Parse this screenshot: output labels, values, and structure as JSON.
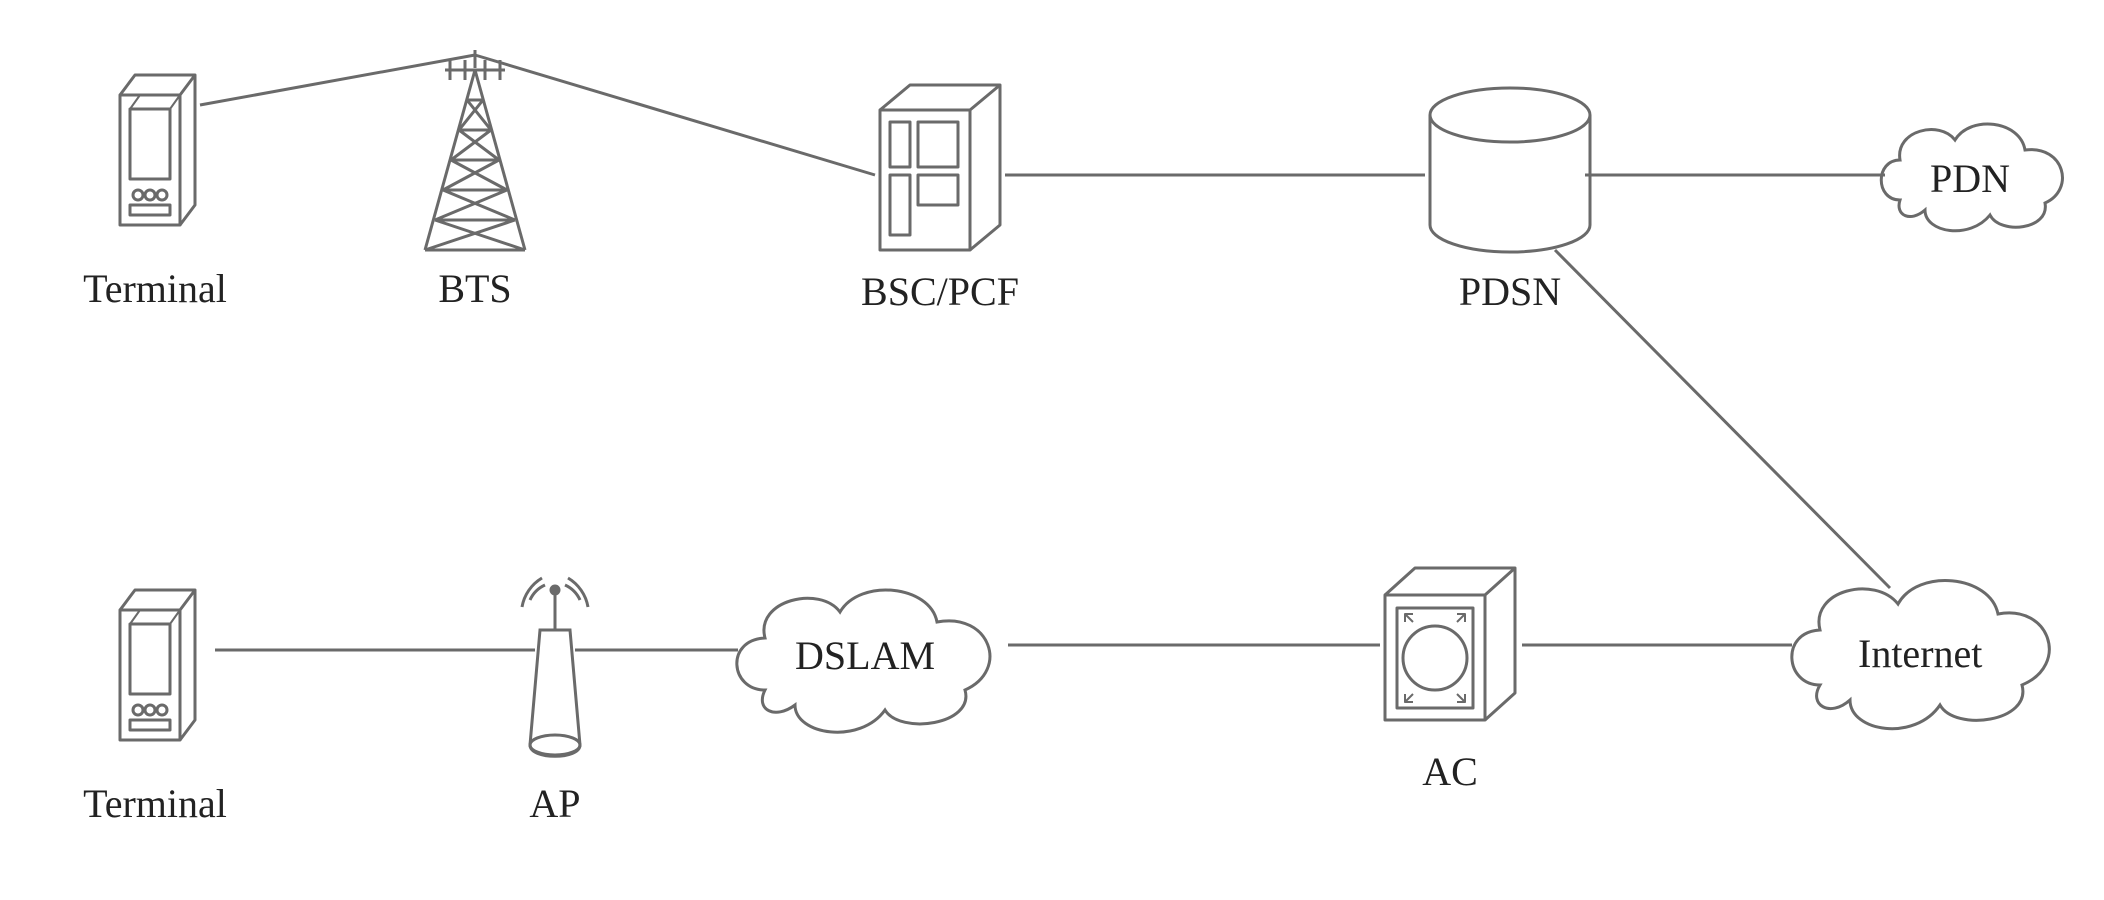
{
  "labels": {
    "terminal1": "Terminal",
    "bts": "BTS",
    "bsc_pcf": "BSC/PCF",
    "pdsn": "PDSN",
    "pdn": "PDN",
    "terminal2": "Terminal",
    "ap": "AP",
    "dslam": "DSLAM",
    "ac": "AC",
    "internet": "Internet"
  },
  "diagram": {
    "style": "network-topology",
    "rows": 2,
    "strokes": "#6a6a6a"
  }
}
